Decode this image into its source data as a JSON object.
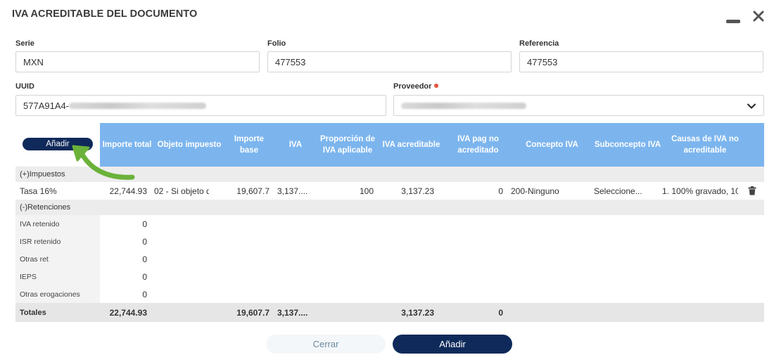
{
  "window": {
    "title": "IVA ACREDITABLE DEL DOCUMENTO"
  },
  "form": {
    "serie": {
      "label": "Serie",
      "value": "MXN"
    },
    "folio": {
      "label": "Folio",
      "value": "477553"
    },
    "referencia": {
      "label": "Referencia",
      "value": "477553"
    },
    "uuid": {
      "label": "UUID",
      "value": "577A91A4-"
    },
    "proveedor": {
      "label": "Proveedor"
    }
  },
  "table": {
    "add_label": "Añadir",
    "headers": [
      "Importe total",
      "Objeto impuesto",
      "Importe base",
      "IVA",
      "Proporción de IVA aplicable",
      "IVA acreditable",
      "IVA pag no acreditado",
      "Concepto IVA",
      "Subconcepto IVA",
      "Causas de IVA no acreditable"
    ],
    "impuestos_label": "(+)Impuestos",
    "tasa_row": {
      "label": "Tasa 16%",
      "importe_total": "22,744.93",
      "objeto_impuesto": "02 - Si objeto d",
      "importe_base": "19,607.7",
      "iva": "3,137....",
      "proporcion": "100",
      "iva_acreditable": "3,137.23",
      "iva_pag_no_acreditado": "0",
      "concepto": "200-Ninguno",
      "subconcepto": "Seleccione...",
      "causas": "1. 100% gravado, 10"
    },
    "retenciones_label": "(-)Retenciones",
    "retenciones": [
      {
        "label": "IVA retenido",
        "value": "0"
      },
      {
        "label": "ISR retenido",
        "value": "0"
      },
      {
        "label": "Otras ret",
        "value": "0"
      },
      {
        "label": "IEPS",
        "value": "0"
      },
      {
        "label": "Otras erogaciones",
        "value": "0"
      }
    ],
    "totales": {
      "label": "Totales",
      "importe_total": "22,744.93",
      "importe_base": "19,607.7",
      "iva": "3,137....",
      "iva_acreditable": "3,137.23",
      "iva_pag_no_acreditado": "0"
    }
  },
  "footer": {
    "cerrar_label": "Cerrar",
    "anadir_label": "Añadir"
  },
  "colors": {
    "header_bg": "#7cb5ee",
    "primary_button": "#0f2a5a",
    "required_dot": "#e8533f",
    "annotation_arrow": "#6ab23a"
  },
  "icons": [
    "minimize-icon",
    "close-icon",
    "chevron-down-icon",
    "trash-icon"
  ]
}
